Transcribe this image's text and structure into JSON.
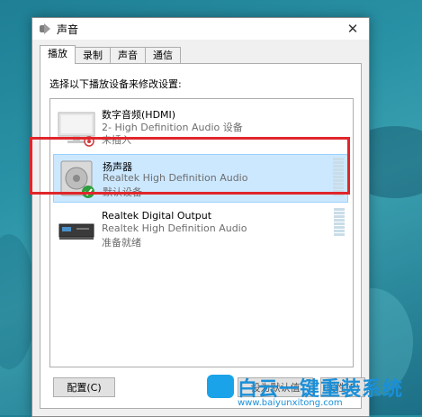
{
  "window": {
    "title": "声音",
    "close_glyph": "✕"
  },
  "tabs": [
    {
      "label": "播放",
      "active": true
    },
    {
      "label": "录制",
      "active": false
    },
    {
      "label": "声音",
      "active": false
    },
    {
      "label": "通信",
      "active": false
    }
  ],
  "panel": {
    "instruction": "选择以下播放设备来修改设置:"
  },
  "devices": [
    {
      "name": "数字音频(HDMI)",
      "description": "2- High Definition Audio 设备",
      "status": "未插入",
      "icon": "monitor-icon",
      "selected": false
    },
    {
      "name": "扬声器",
      "description": "Realtek High Definition Audio",
      "status": "默认设备",
      "icon": "speaker-icon",
      "selected": true
    },
    {
      "name": "Realtek Digital Output",
      "description": "Realtek High Definition Audio",
      "status": "准备就绪",
      "icon": "digital-output-icon",
      "selected": false
    }
  ],
  "buttons": {
    "configure": "配置(C)",
    "set_default": "设为默认值",
    "properties": "属性(P)"
  },
  "watermark": {
    "title": "白云一键重装系统",
    "url": "www.baiyunxitong.com"
  },
  "colors": {
    "selection": "#cce8ff",
    "highlight_box": "#e0262b",
    "check": "#2e9e3e"
  }
}
